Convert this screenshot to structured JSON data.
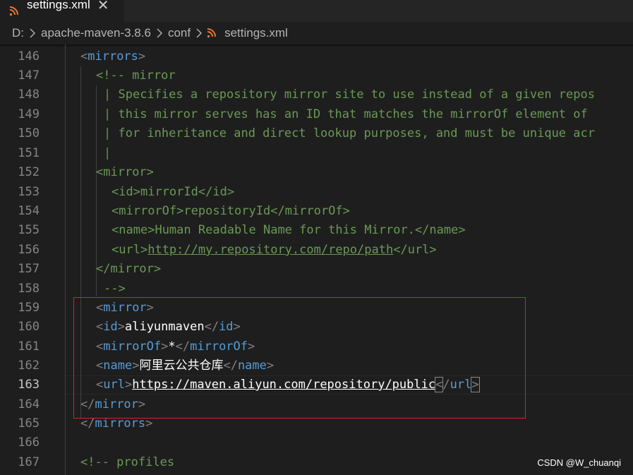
{
  "tab": {
    "filename": "settings.xml",
    "close": "✕"
  },
  "breadcrumb": {
    "drive": "D:",
    "folder1": "apache-maven-3.8.6",
    "folder2": "conf",
    "file": "settings.xml"
  },
  "lines": [
    {
      "n": "146"
    },
    {
      "n": "147"
    },
    {
      "n": "148"
    },
    {
      "n": "149"
    },
    {
      "n": "150"
    },
    {
      "n": "151"
    },
    {
      "n": "152"
    },
    {
      "n": "153"
    },
    {
      "n": "154"
    },
    {
      "n": "155"
    },
    {
      "n": "156"
    },
    {
      "n": "157"
    },
    {
      "n": "158"
    },
    {
      "n": "159"
    },
    {
      "n": "160"
    },
    {
      "n": "161"
    },
    {
      "n": "162"
    },
    {
      "n": "163"
    },
    {
      "n": "164"
    },
    {
      "n": "165"
    },
    {
      "n": "166"
    },
    {
      "n": "167"
    }
  ],
  "active_line": "163",
  "code": {
    "mirrors": "mirrors",
    "comment_open": "<!-- mirror",
    "comment_bar": "|",
    "c148": " Specifies a repository mirror site to use instead of a given repos",
    "c149": " this mirror serves has an ID that matches the mirrorOf element of",
    "c150": " for inheritance and direct lookup purposes, and must be unique acr",
    "mirror": "mirror",
    "id": "id",
    "mirrorOf": "mirrorOf",
    "name": "name",
    "url": "url",
    "ex_id": "mirrorId",
    "ex_mirrorOf": "repositoryId",
    "ex_name": "Human Readable Name for this Mirror.",
    "ex_url": "http://my.repository.com/repo/path",
    "comment_close": "-->",
    "ali_id": "aliyunmaven",
    "ali_mirrorOf": "*",
    "ali_name": "阿里云公共仓库",
    "ali_url": "https://maven.aliyun.com/repository/public",
    "profiles": "<!-- profiles"
  },
  "watermark": "CSDN @W_chuanqi",
  "colors": {
    "background": "#1e1e1e",
    "tag": "#569cd6",
    "comment": "#6a9955",
    "highlight_box": "#e0202a"
  }
}
